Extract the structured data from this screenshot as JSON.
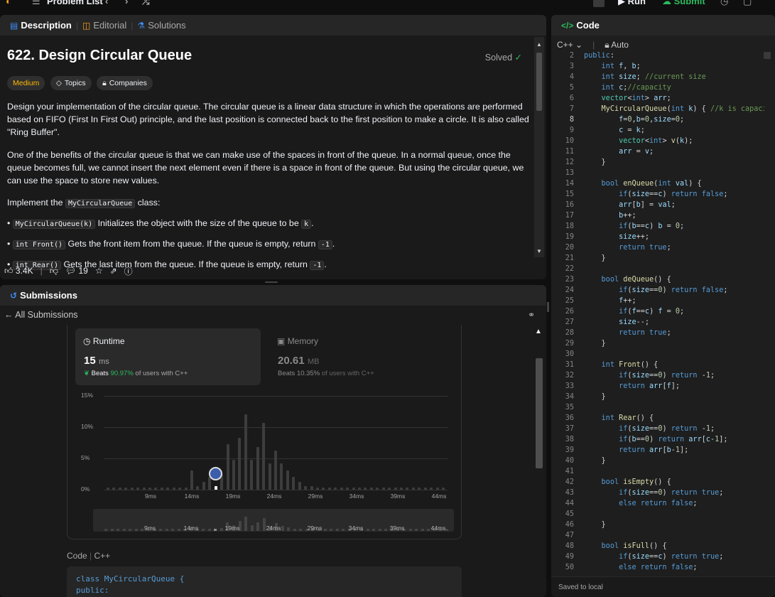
{
  "topbar": {
    "problem_list": "Problem List",
    "run": "Run",
    "submit": "Submit"
  },
  "desc_panel": {
    "tabs": [
      {
        "label": "Description"
      },
      {
        "label": "Editorial"
      },
      {
        "label": "Solutions"
      }
    ],
    "title": "622. Design Circular Queue",
    "solved": "Solved",
    "difficulty": "Medium",
    "topics": "Topics",
    "companies": "Companies",
    "para1": "Design your implementation of the circular queue. The circular queue is a linear data structure in which the operations are performed based on FIFO (First In First Out) principle, and the last position is connected back to the first position to make a circle. It is also called \"Ring Buffer\".",
    "para2": "One of the benefits of the circular queue is that we can make use of the spaces in front of the queue. In a normal queue, once the queue becomes full, we cannot insert the next element even if there is a space in front of the queue. But using the circular queue, we can use the space to store new values.",
    "impl_prefix": "Implement the",
    "impl_code": "MyCircularQueue",
    "impl_suffix": "class:",
    "bullets": [
      {
        "code": "MyCircularQueue(k)",
        "text": "Initializes the object with the size of the queue to be",
        "code2": "k",
        "end": "."
      },
      {
        "code": "int Front()",
        "text": "Gets the front item from the queue. If the queue is empty, return",
        "code2": "-1",
        "end": "."
      },
      {
        "code": "int Rear()",
        "text": "Gets the last item from the queue. If the queue is empty, return",
        "code2": "-1",
        "end": "."
      }
    ],
    "likes": "3.4K",
    "comments": "19"
  },
  "submissions": {
    "title": "Submissions",
    "back": "All Submissions",
    "runtime": {
      "label": "Runtime",
      "value": "15",
      "unit": "ms",
      "beats_prefix": "Beats",
      "beats": "90.97%",
      "beats_suffix": "of users with C++"
    },
    "memory": {
      "label": "Memory",
      "value": "20.61",
      "unit": "MB",
      "beats_prefix": "Beats",
      "beats": "10.35%",
      "beats_suffix": "of users with C++"
    },
    "code_label": "Code",
    "lang": "C++",
    "snippet": [
      "class MyCircularQueue {",
      "public:"
    ]
  },
  "code_panel": {
    "title": "Code",
    "lang": "C++",
    "auto": "Auto",
    "saved": "Saved to local",
    "lines": [
      {
        "n": "2",
        "html": "<span class='kw'>public</span>:"
      },
      {
        "n": "3",
        "html": "    <span class='kw'>int</span> <span class='vr'>f</span>, <span class='vr'>b</span>;"
      },
      {
        "n": "4",
        "html": "    <span class='kw'>int</span> <span class='vr'>size</span>; <span class='cm'>//current size</span>"
      },
      {
        "n": "5",
        "html": "    <span class='kw'>int</span> <span class='vr'>c</span>;<span class='cm'>//capacity</span>"
      },
      {
        "n": "6",
        "html": "    <span class='ty'>vector</span>&lt;<span class='kw'>int</span>&gt; <span class='vr'>arr</span>;"
      },
      {
        "n": "7",
        "html": "    <span class='fn'>MyCircularQueue</span>(<span class='kw'>int</span> <span class='vr'>k</span>) { <span class='cm'>//k is capacity</span>"
      },
      {
        "n": "8",
        "html": "        <span class='vr'>f</span>=<span class='nm'>0</span>,<span class='vr'>b</span>=<span class='nm'>0</span>,<span class='vr'>size</span>=<span class='nm'>0</span>;"
      },
      {
        "n": "9",
        "html": "        <span class='vr'>c</span> = <span class='vr'>k</span>;"
      },
      {
        "n": "10",
        "html": "        <span class='ty'>vector</span>&lt;<span class='kw'>int</span>&gt; <span class='fn'>v</span>(<span class='vr'>k</span>);"
      },
      {
        "n": "11",
        "html": "        <span class='vr'>arr</span> = <span class='vr'>v</span>;"
      },
      {
        "n": "12",
        "html": "    }"
      },
      {
        "n": "13",
        "html": ""
      },
      {
        "n": "14",
        "html": "    <span class='kw'>bool</span> <span class='fn'>enQueue</span>(<span class='kw'>int</span> <span class='vr'>val</span>) {"
      },
      {
        "n": "15",
        "html": "        <span class='kw'>if</span>(<span class='vr'>size</span>==<span class='vr'>c</span>) <span class='kw'>return</span> <span class='kw'>false</span>;"
      },
      {
        "n": "16",
        "html": "        <span class='vr'>arr</span>[<span class='vr'>b</span>] = <span class='vr'>val</span>;"
      },
      {
        "n": "17",
        "html": "        <span class='vr'>b</span>++;"
      },
      {
        "n": "18",
        "html": "        <span class='kw'>if</span>(<span class='vr'>b</span>==<span class='vr'>c</span>) <span class='vr'>b</span> = <span class='nm'>0</span>;"
      },
      {
        "n": "19",
        "html": "        <span class='vr'>size</span>++;"
      },
      {
        "n": "20",
        "html": "        <span class='kw'>return</span> <span class='kw'>true</span>;"
      },
      {
        "n": "21",
        "html": "    }"
      },
      {
        "n": "22",
        "html": ""
      },
      {
        "n": "23",
        "html": "    <span class='kw'>bool</span> <span class='fn'>deQueue</span>() {"
      },
      {
        "n": "24",
        "html": "        <span class='kw'>if</span>(<span class='vr'>size</span>==<span class='nm'>0</span>) <span class='kw'>return</span> <span class='kw'>false</span>;"
      },
      {
        "n": "25",
        "html": "        <span class='vr'>f</span>++;"
      },
      {
        "n": "26",
        "html": "        <span class='kw'>if</span>(<span class='vr'>f</span>==<span class='vr'>c</span>) <span class='vr'>f</span> = <span class='nm'>0</span>;"
      },
      {
        "n": "27",
        "html": "        <span class='vr'>size</span>--;"
      },
      {
        "n": "28",
        "html": "        <span class='kw'>return</span> <span class='kw'>true</span>;"
      },
      {
        "n": "29",
        "html": "    }"
      },
      {
        "n": "30",
        "html": ""
      },
      {
        "n": "31",
        "html": "    <span class='kw'>int</span> <span class='fn'>Front</span>() {"
      },
      {
        "n": "32",
        "html": "        <span class='kw'>if</span>(<span class='vr'>size</span>==<span class='nm'>0</span>) <span class='kw'>return</span> -<span class='nm'>1</span>;"
      },
      {
        "n": "33",
        "html": "        <span class='kw'>return</span> <span class='vr'>arr</span>[<span class='vr'>f</span>];"
      },
      {
        "n": "34",
        "html": "    }"
      },
      {
        "n": "35",
        "html": ""
      },
      {
        "n": "36",
        "html": "    <span class='kw'>int</span> <span class='fn'>Rear</span>() {"
      },
      {
        "n": "37",
        "html": "        <span class='kw'>if</span>(<span class='vr'>size</span>==<span class='nm'>0</span>) <span class='kw'>return</span> -<span class='nm'>1</span>;"
      },
      {
        "n": "38",
        "html": "        <span class='kw'>if</span>(<span class='vr'>b</span>==<span class='nm'>0</span>) <span class='kw'>return</span> <span class='vr'>arr</span>[<span class='vr'>c</span>-<span class='nm'>1</span>];"
      },
      {
        "n": "39",
        "html": "        <span class='kw'>return</span> <span class='vr'>arr</span>[<span class='vr'>b</span>-<span class='nm'>1</span>];"
      },
      {
        "n": "40",
        "html": "    }"
      },
      {
        "n": "41",
        "html": ""
      },
      {
        "n": "42",
        "html": "    <span class='kw'>bool</span> <span class='fn'>isEmpty</span>() {"
      },
      {
        "n": "43",
        "html": "        <span class='kw'>if</span>(<span class='vr'>size</span>==<span class='nm'>0</span>) <span class='kw'>return</span> <span class='kw'>true</span>;"
      },
      {
        "n": "44",
        "html": "        <span class='kw'>else</span> <span class='kw'>return</span> <span class='kw'>false</span>;"
      },
      {
        "n": "45",
        "html": ""
      },
      {
        "n": "46",
        "html": "    }"
      },
      {
        "n": "47",
        "html": ""
      },
      {
        "n": "48",
        "html": "    <span class='kw'>bool</span> <span class='fn'>isFull</span>() {"
      },
      {
        "n": "49",
        "html": "        <span class='kw'>if</span>(<span class='vr'>size</span>==<span class='vr'>c</span>) <span class='kw'>return</span> <span class='kw'>true</span>;"
      },
      {
        "n": "50",
        "html": "        <span class='kw'>else</span> <span class='kw'>return</span> <span class='kw'>false</span>;"
      }
    ]
  },
  "chart_data": {
    "type": "bar",
    "xlabels": [
      "9ms",
      "14ms",
      "19ms",
      "24ms",
      "29ms",
      "34ms",
      "39ms",
      "44ms"
    ],
    "ylabels": [
      "15%",
      "10%",
      "5%",
      "0%"
    ],
    "ylim": [
      0,
      15
    ],
    "values": [
      0.3,
      0.3,
      0.3,
      0.3,
      0.3,
      0.3,
      0.3,
      0.3,
      0.3,
      0.3,
      0.3,
      0.3,
      0.3,
      0.3,
      3.1,
      0.6,
      1.2,
      2.0,
      0.6,
      2.5,
      7.3,
      4.8,
      8.3,
      12.0,
      4.8,
      6.8,
      10.7,
      4.2,
      6.3,
      4.2,
      3.1,
      2.0,
      1.2,
      0.6,
      0.6,
      0.3,
      0.3,
      0.3,
      0.3,
      0.3,
      0.3,
      0.3,
      0.3,
      0.3,
      0.3,
      0.3,
      0.3,
      0.3,
      0.3,
      0.3,
      0.3,
      0.3,
      0.3,
      0.3,
      0.3,
      0.3,
      0.3
    ],
    "highlight_index": 18,
    "colors": {
      "bar": "#3d3d3d",
      "highlight": "#ffffff",
      "accent": "#2cbb5d"
    }
  }
}
